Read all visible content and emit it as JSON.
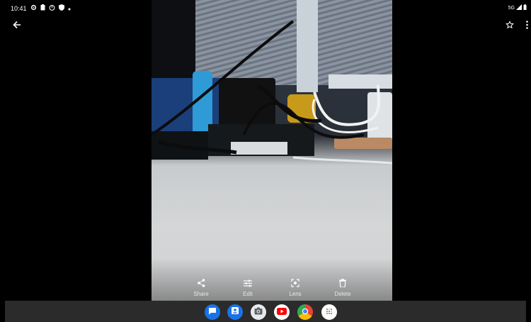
{
  "status_bar": {
    "time": "10:41",
    "icons_left": [
      "settings-icon",
      "clipboard-icon",
      "timer-icon",
      "shield-icon",
      "dot-icon"
    ],
    "icons_right": [
      "wifi-icon",
      "signal-icon",
      "battery-icon"
    ],
    "network_label": "5G"
  },
  "top_bar": {
    "icons": [
      "back-arrow-icon",
      "star-outline-icon",
      "more-vert-icon"
    ]
  },
  "photo": {
    "subject": "desk-with-cables"
  },
  "actions": [
    {
      "label": "Share",
      "icon": "share-icon"
    },
    {
      "label": "Edit",
      "icon": "tune-icon"
    },
    {
      "label": "Lens",
      "icon": "lens-icon"
    },
    {
      "label": "Delete",
      "icon": "trash-icon"
    }
  ],
  "taskbar": {
    "apps": [
      {
        "icon": "messages-icon",
        "color": "#1a73e8"
      },
      {
        "icon": "contacts-icon",
        "color": "#1a73e8"
      },
      {
        "icon": "camera-icon",
        "color": "#5f6368"
      },
      {
        "icon": "youtube-icon",
        "color": "#ff0000"
      },
      {
        "icon": "chrome-icon",
        "color": "#4285f4"
      },
      {
        "icon": "app-drawer-icon",
        "color": "#ffffff"
      }
    ]
  },
  "colors": {
    "background": "#000000",
    "taskbar": "#2b2b2b",
    "text": "#ffffff"
  }
}
